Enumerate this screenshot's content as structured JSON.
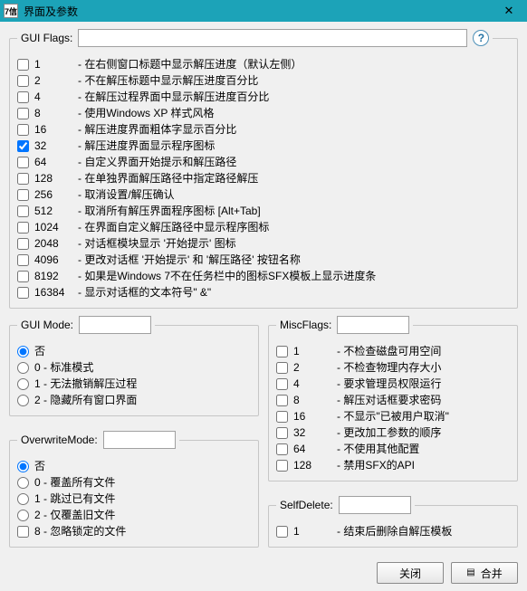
{
  "title": "界面及参数",
  "app_icon_text": "7信",
  "gui_flags": {
    "label": "GUI Flags:",
    "value": "",
    "items": [
      {
        "num": "1",
        "desc": "- 在右侧窗口标题中显示解压进度（默认左侧）"
      },
      {
        "num": "2",
        "desc": "- 不在解压标题中显示解压进度百分比"
      },
      {
        "num": "4",
        "desc": "- 在解压过程界面中显示解压进度百分比"
      },
      {
        "num": "8",
        "desc": "- 使用Windows XP 样式风格"
      },
      {
        "num": "16",
        "desc": "- 解压进度界面粗体字显示百分比"
      },
      {
        "num": "32",
        "desc": "- 解压进度界面显示程序图标",
        "checked": true
      },
      {
        "num": "64",
        "desc": "- 自定义界面开始提示和解压路径"
      },
      {
        "num": "128",
        "desc": "- 在单独界面解压路径中指定路径解压"
      },
      {
        "num": "256",
        "desc": "- 取消设置/解压确认"
      },
      {
        "num": "512",
        "desc": "- 取消所有解压界面程序图标 [Alt+Tab]"
      },
      {
        "num": "1024",
        "desc": "- 在界面自定义解压路径中显示程序图标"
      },
      {
        "num": "2048",
        "desc": "- 对话框模块显示 '开始提示' 图标"
      },
      {
        "num": "4096",
        "desc": "- 更改对话框 '开始提示' 和 '解压路径' 按钮名称"
      },
      {
        "num": "8192",
        "desc": "- 如果是Windows 7不在任务栏中的图标SFX模板上显示进度条"
      },
      {
        "num": "16384",
        "desc": "- 显示对话框的文本符号\" &\""
      }
    ]
  },
  "gui_mode": {
    "label": "GUI Mode:",
    "value": "",
    "items": [
      {
        "label": "否",
        "checked": true
      },
      {
        "label": "0 - 标准模式"
      },
      {
        "label": "1 - 无法撤销解压过程"
      },
      {
        "label": "2 - 隐藏所有窗口界面"
      }
    ]
  },
  "overwrite_mode": {
    "label": "OverwriteMode:",
    "value": "",
    "items": [
      {
        "label": "否",
        "checked": true
      },
      {
        "label": "0 - 覆盖所有文件"
      },
      {
        "label": "1 - 跳过已有文件"
      },
      {
        "label": "2 - 仅覆盖旧文件"
      },
      {
        "label": "8 - 忽略锁定的文件",
        "type": "checkbox"
      }
    ]
  },
  "misc_flags": {
    "label": "MiscFlags:",
    "value": "",
    "items": [
      {
        "num": "1",
        "desc": "- 不检查磁盘可用空间"
      },
      {
        "num": "2",
        "desc": "- 不检查物理内存大小"
      },
      {
        "num": "4",
        "desc": "- 要求管理员权限运行"
      },
      {
        "num": "8",
        "desc": "- 解压对话框要求密码"
      },
      {
        "num": "16",
        "desc": "- 不显示\"已被用户取消\""
      },
      {
        "num": "32",
        "desc": "- 更改加工参数的顺序"
      },
      {
        "num": "64",
        "desc": "- 不使用其他配置"
      },
      {
        "num": "128",
        "desc": "- 禁用SFX的API"
      }
    ]
  },
  "self_delete": {
    "label": "SelfDelete:",
    "value": "",
    "items": [
      {
        "num": "1",
        "desc": "- 结束后删除自解压模板"
      }
    ]
  },
  "buttons": {
    "close": "关闭",
    "merge": "合并"
  }
}
